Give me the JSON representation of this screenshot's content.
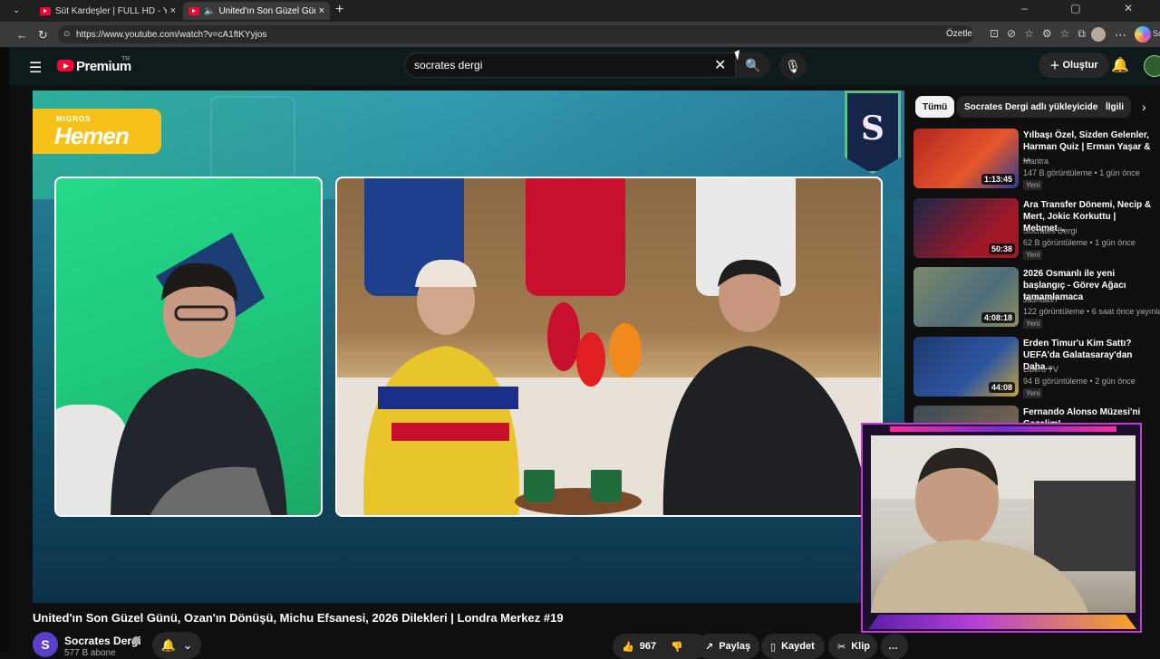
{
  "browser": {
    "tabs": [
      {
        "title": "Süt Kardeşler | FULL HD - YouTube",
        "close": "×"
      },
      {
        "title": "United'ın Son Güzel Günü, Oza...",
        "close": "×"
      }
    ],
    "new_tab": "+",
    "window_controls": "–  ▢  ✕",
    "url": "https://www.youtube.com/watch?v=cA1ftKYyjos",
    "summarize_label": "Özetle",
    "copilot_label": "Sc"
  },
  "youtube": {
    "brand": "Premium",
    "region": "TR",
    "search_value": "socrates dergi",
    "create_label": "Oluştur",
    "icons": {
      "menu": "☰",
      "search": "🔍",
      "mic": "🎙",
      "bell": "🔔",
      "clear": "✕"
    }
  },
  "player": {
    "sponsor_top": "MIGROS",
    "sponsor_name": "Hemen",
    "badge_letter": "S"
  },
  "video": {
    "title": "United'ın Son Güzel Günü, Ozan'ın Dönüşü, Michu Efsanesi, 2026 Dilekleri | Londra Merkez #19",
    "channel": "Socrates Dergi",
    "channel_initial": "S",
    "subs": "577 B abone",
    "likes": "967",
    "share": "Paylaş",
    "save": "Kaydet",
    "clip": "Klip",
    "more": "…"
  },
  "sidebar": {
    "chips": [
      "Tümü",
      "Socrates Dergi adlı yükleyiciden",
      "İlgili"
    ],
    "recommendations": [
      {
        "title": "Yılbaşı Özel, Sizden Gelenler, Harman Quiz | Erman Yaşar & ...",
        "channel": "Mantra",
        "meta": "147 B görüntüleme • 1 gün önce",
        "badge": "Yeni",
        "duration": "1:13:45",
        "thumb_color": "#b3261e"
      },
      {
        "title": "Ara Transfer Dönemi, Necip & Mert, Jokic Korkuttu | Mehmet...",
        "channel": "Socrates Dergi",
        "meta": "62 B görüntüleme • 1 gün önce",
        "badge": "Yeni",
        "duration": "50:38",
        "thumb_color": "#1c2747"
      },
      {
        "title": "2026 Osmanlı ile yeni başlangıç - Görev Ağacı tamamlamaca",
        "channel": "Jashua97",
        "meta": "122 görüntüleme • 6 saat önce yayınlandı",
        "badge": "Yeni",
        "duration": "4:08:18",
        "thumb_color": "#556b52"
      },
      {
        "title": "Erden Timur'u Kim Sattı? UEFA'da Galatasaray'dan Daha...",
        "channel": "Libero TV",
        "meta": "94 B görüntüleme • 2 gün önce",
        "badge": "Yeni",
        "duration": "44:08",
        "thumb_color": "#1e3a6e"
      },
      {
        "title": "Fernando Alonso Müzesi'ni Gezelim!",
        "channel": "",
        "meta": "",
        "badge": "",
        "duration": "",
        "thumb_color": "#3b4a55"
      }
    ]
  }
}
